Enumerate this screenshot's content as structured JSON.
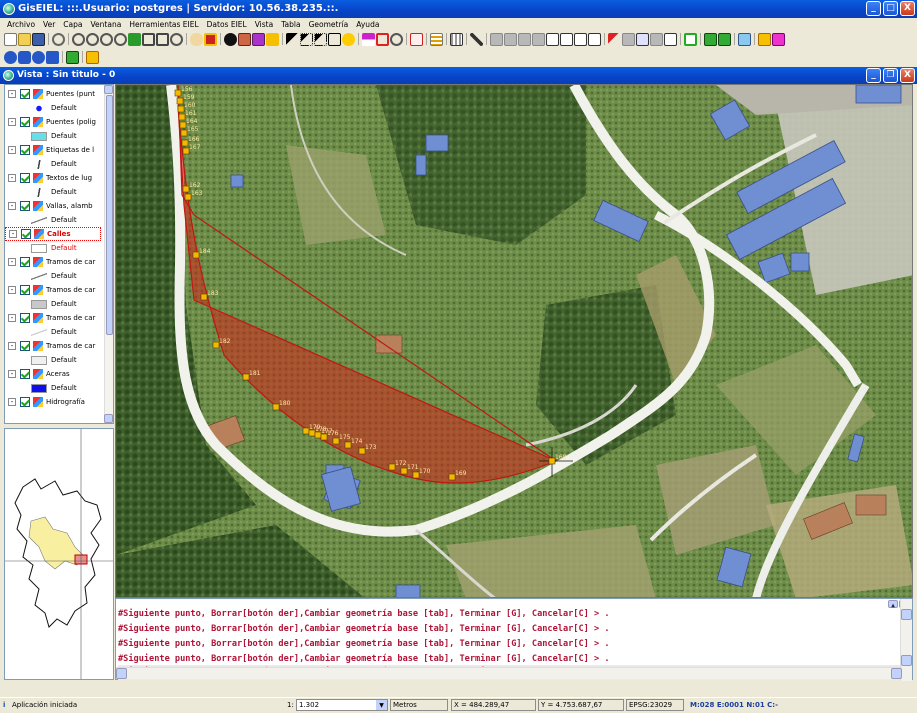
{
  "window": {
    "title": "GisEIEL: :::.Usuario: postgres | Servidor: 10.56.38.235.::.",
    "minimize": "_",
    "maximize": "□",
    "close": "X"
  },
  "menu": [
    "Archivo",
    "Ver",
    "Capa",
    "Ventana",
    "Herramientas EIEL",
    "Datos EIEL",
    "Vista",
    "Tabla",
    "Geometría",
    "Ayuda"
  ],
  "vista": {
    "title": "Vista : Sin titulo - 0",
    "minimize": "_",
    "maximize": "❐",
    "close": "X"
  },
  "legend": {
    "toggle_symbol": "-",
    "items": [
      {
        "label": "Puentes (punt",
        "sublabel": "Default",
        "symbol_color": "#1a1aff",
        "symbol_type": "point"
      },
      {
        "label": "Puentes (polig",
        "sublabel": "Default",
        "symbol_color": "#66e0e8",
        "symbol_type": "fill"
      },
      {
        "label": "Etiquetas de l",
        "sublabel": "Default",
        "symbol_color": "#777777",
        "symbol_type": "text"
      },
      {
        "label": "Textos de lug",
        "sublabel": "Default",
        "symbol_color": "#777777",
        "symbol_type": "text"
      },
      {
        "label": "Vallas, alamb",
        "sublabel": "Default",
        "symbol_color": "#777777",
        "symbol_type": "line"
      },
      {
        "label": "Calles",
        "sublabel": "Default",
        "symbol_color": "#ffffff",
        "symbol_type": "fill",
        "active": true
      },
      {
        "label": "Tramos de car",
        "sublabel": "Default",
        "symbol_color": "#777777",
        "symbol_type": "line"
      },
      {
        "label": "Tramos de car",
        "sublabel": "Default",
        "symbol_color": "#c8c8c8",
        "symbol_type": "fill"
      },
      {
        "label": "Tramos de car",
        "sublabel": "Default",
        "symbol_color": "#cccccc",
        "symbol_type": "line"
      },
      {
        "label": "Tramos de car",
        "sublabel": "Default",
        "symbol_color": "#f0f0f0",
        "symbol_type": "fill"
      },
      {
        "label": "Aceras",
        "sublabel": "Default",
        "symbol_color": "#1010ee",
        "symbol_type": "fill"
      },
      {
        "label": "Hidrografía",
        "sublabel": "",
        "symbol_color": "#1a1aff",
        "symbol_type": "fill"
      }
    ]
  },
  "vertex_labels": [
    "156",
    "159",
    "160",
    "161",
    "164",
    "165",
    "166",
    "167",
    "162",
    "163",
    "184",
    "183",
    "182",
    "181",
    "180",
    "179",
    "178",
    "177",
    "176",
    "175",
    "174",
    "173",
    "172",
    "171",
    "170",
    "169",
    "168"
  ],
  "console": {
    "prompt_line": "#Siguiente punto, Borrar[botón der],Cambiar geometría base [tab], Terminar [G], Cancelar[C] > .",
    "line_count": 5
  },
  "status": {
    "message": "Aplicación iniciada",
    "info_icon": "i",
    "scale_prefix": "1:",
    "scale_value": "1.302",
    "units": "Metros",
    "x_coord": "X = 484.289,47",
    "y_coord": "Y = 4.753.687,67",
    "epsg": "EPSG:23029",
    "mode": "M:028 E:0001  N:01  C:-"
  },
  "colors": {
    "title_blue": "#0a4fd8",
    "polygon_fill": "#d4231b",
    "vertex": "#f5b800",
    "console_text": "#b01538"
  }
}
